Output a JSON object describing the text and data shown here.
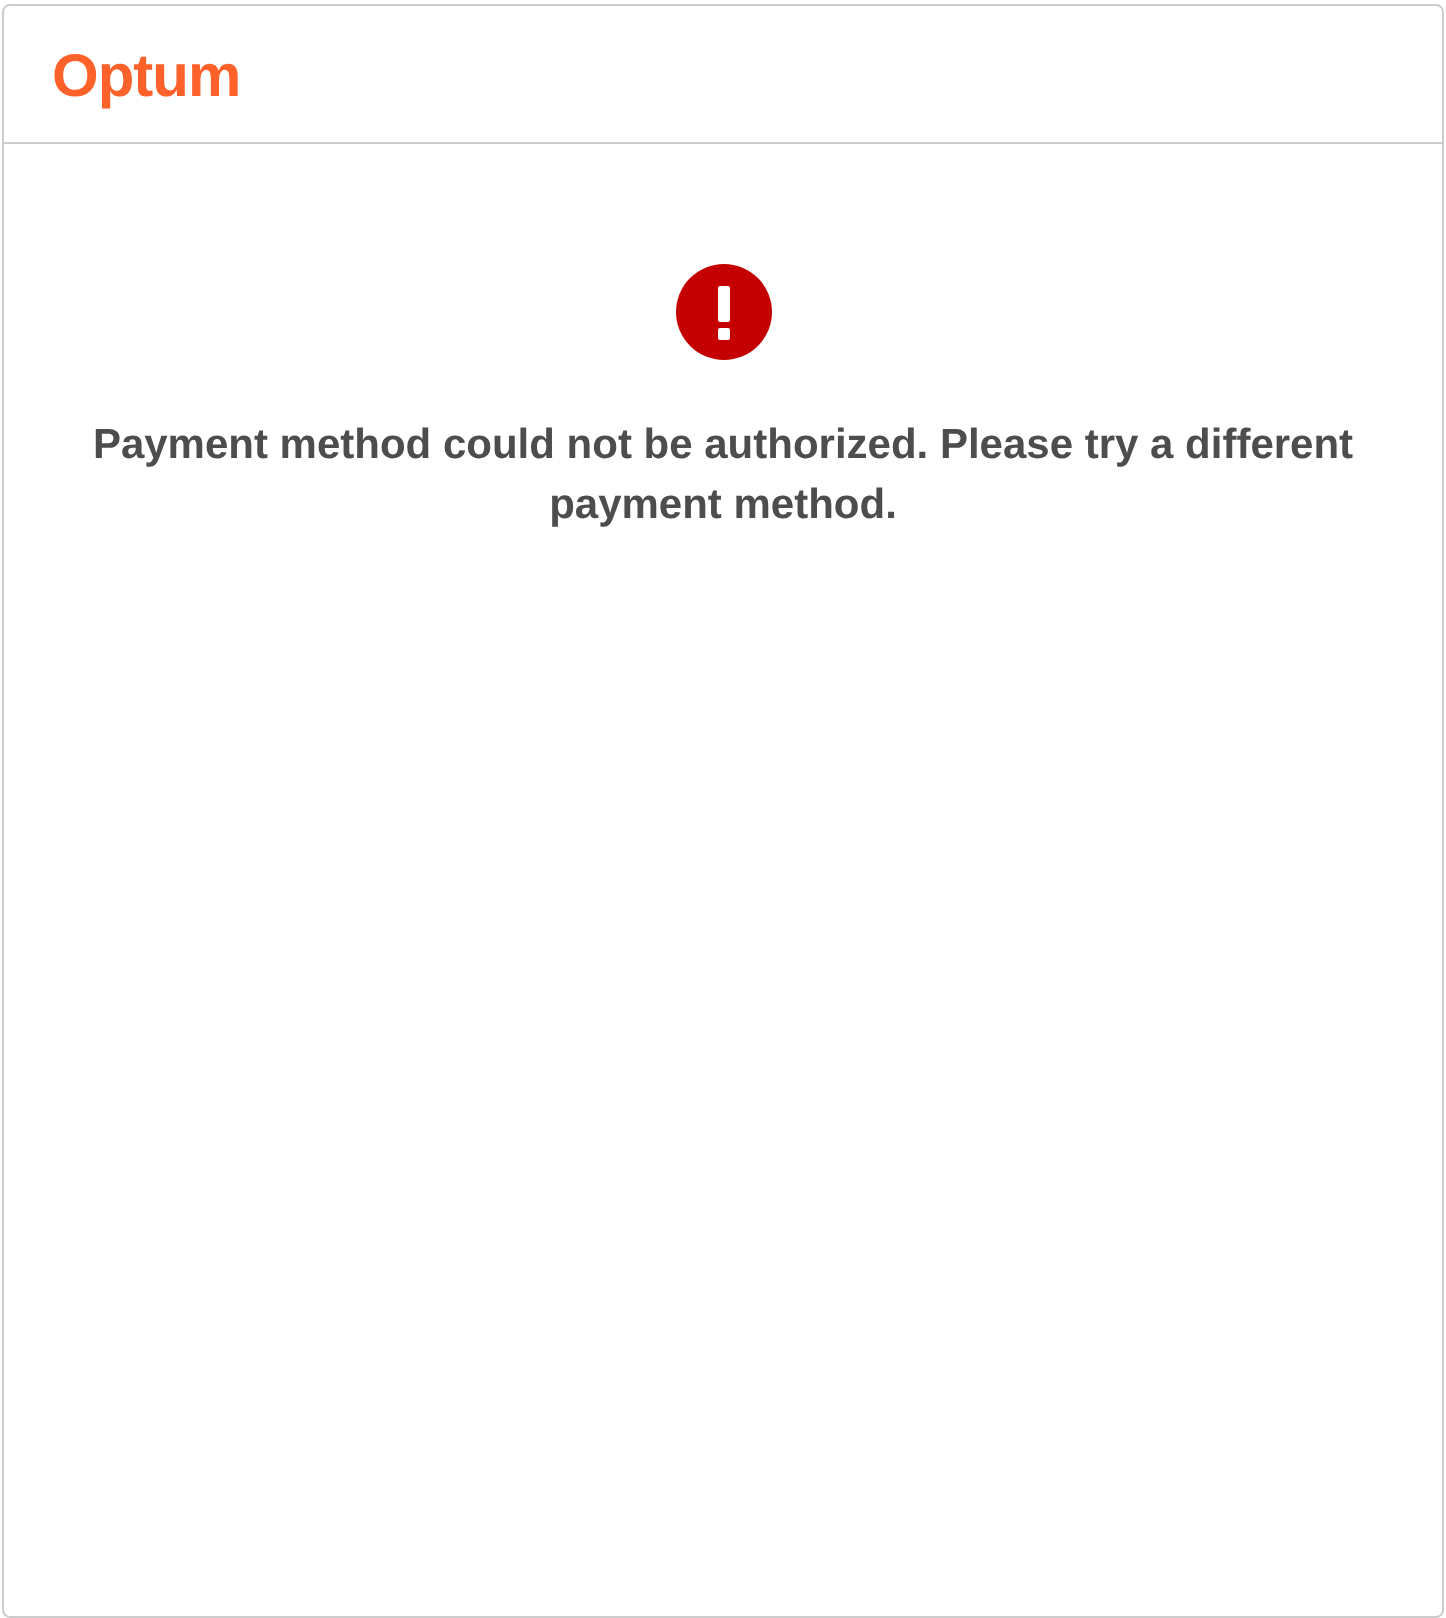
{
  "header": {
    "logo": "Optum"
  },
  "message": {
    "kind": "error",
    "text": "Payment method could not be authorized. Please try a different payment method."
  }
}
